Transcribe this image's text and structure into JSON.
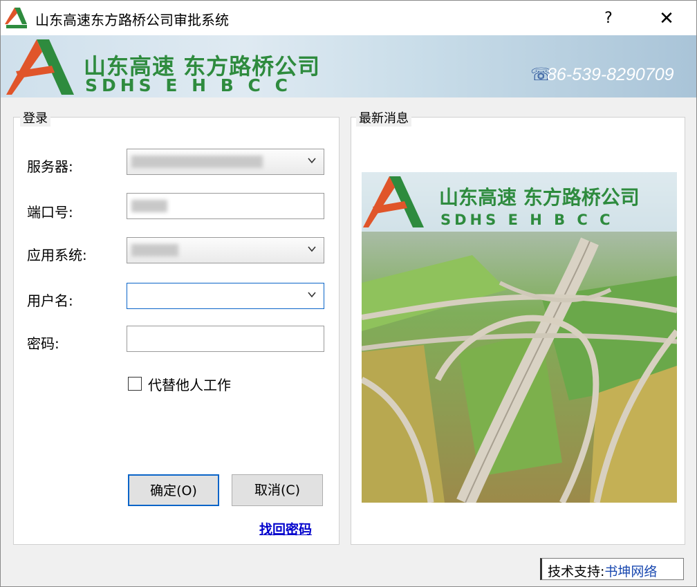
{
  "window": {
    "title": "山东高速东方路桥公司审批系统",
    "help": "?",
    "close": "✕"
  },
  "banner": {
    "company_cn": "山东高速 东方路桥公司",
    "company_en": "SDHS  E  H  B  C  C",
    "phone": "86-539-8290709",
    "logo_color_green": "#2e8b3e",
    "logo_color_red": "#e0552a"
  },
  "login": {
    "group_title": "登录",
    "server_label": "服务器:",
    "port_label": "端口号:",
    "app_label": "应用系统:",
    "user_label": "用户名:",
    "password_label": "密码:",
    "proxy_label": "代替他人工作",
    "ok_button": "确定(O)",
    "cancel_button": "取消(C)",
    "forgot_link": "找回密码"
  },
  "news": {
    "group_title": "最新消息",
    "image_cn": "山东高速 东方路桥公司",
    "image_en": "SDHS  E  H  B  C  C"
  },
  "footer": {
    "support_label": "技术支持:",
    "support_name": "书坤网络"
  },
  "colors": {
    "accent": "#0a64c8",
    "link": "#0000cc"
  }
}
